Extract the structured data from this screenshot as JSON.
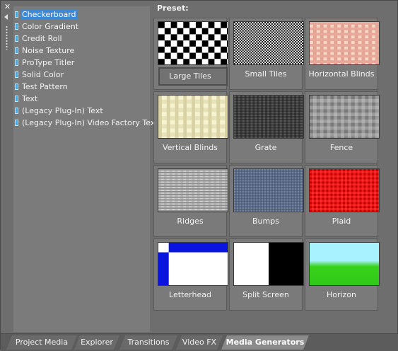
{
  "tree": {
    "items": [
      {
        "label": "Checkerboard",
        "selected": true
      },
      {
        "label": "Color Gradient"
      },
      {
        "label": "Credit Roll"
      },
      {
        "label": "Noise Texture"
      },
      {
        "label": "ProType Titler"
      },
      {
        "label": "Solid Color"
      },
      {
        "label": "Test Pattern"
      },
      {
        "label": "Text"
      },
      {
        "label": "(Legacy Plug-In) Text"
      },
      {
        "label": "(Legacy Plug-In) Video Factory Text"
      }
    ]
  },
  "preset": {
    "label": "Preset:",
    "items": [
      {
        "label": "Large Tiles",
        "pattern": "large-tiles",
        "selected": true
      },
      {
        "label": "Small Tiles",
        "pattern": "small-tiles"
      },
      {
        "label": "Horizontal Blinds",
        "pattern": "horizontal-blinds"
      },
      {
        "label": "Vertical Blinds",
        "pattern": "vertical-blinds"
      },
      {
        "label": "Grate",
        "pattern": "grate"
      },
      {
        "label": "Fence",
        "pattern": "fence"
      },
      {
        "label": "Ridges",
        "pattern": "ridges"
      },
      {
        "label": "Bumps",
        "pattern": "bumps"
      },
      {
        "label": "Plaid",
        "pattern": "plaid"
      },
      {
        "label": "Letterhead",
        "pattern": "letterhead"
      },
      {
        "label": "Split Screen",
        "pattern": "split-screen"
      },
      {
        "label": "Horizon",
        "pattern": "horizon"
      }
    ]
  },
  "tabs": [
    {
      "label": "Project Media"
    },
    {
      "label": "Explorer"
    },
    {
      "label": "Transitions"
    },
    {
      "label": "Video FX"
    },
    {
      "label": "Media Generators",
      "active": true
    }
  ],
  "colors": {
    "selection": "#3b88d6",
    "panel": "#7b7b7b"
  },
  "icons": {
    "close": "close-icon",
    "collapse": "chevron-left-icon",
    "grip": "grip-dots-icon"
  }
}
